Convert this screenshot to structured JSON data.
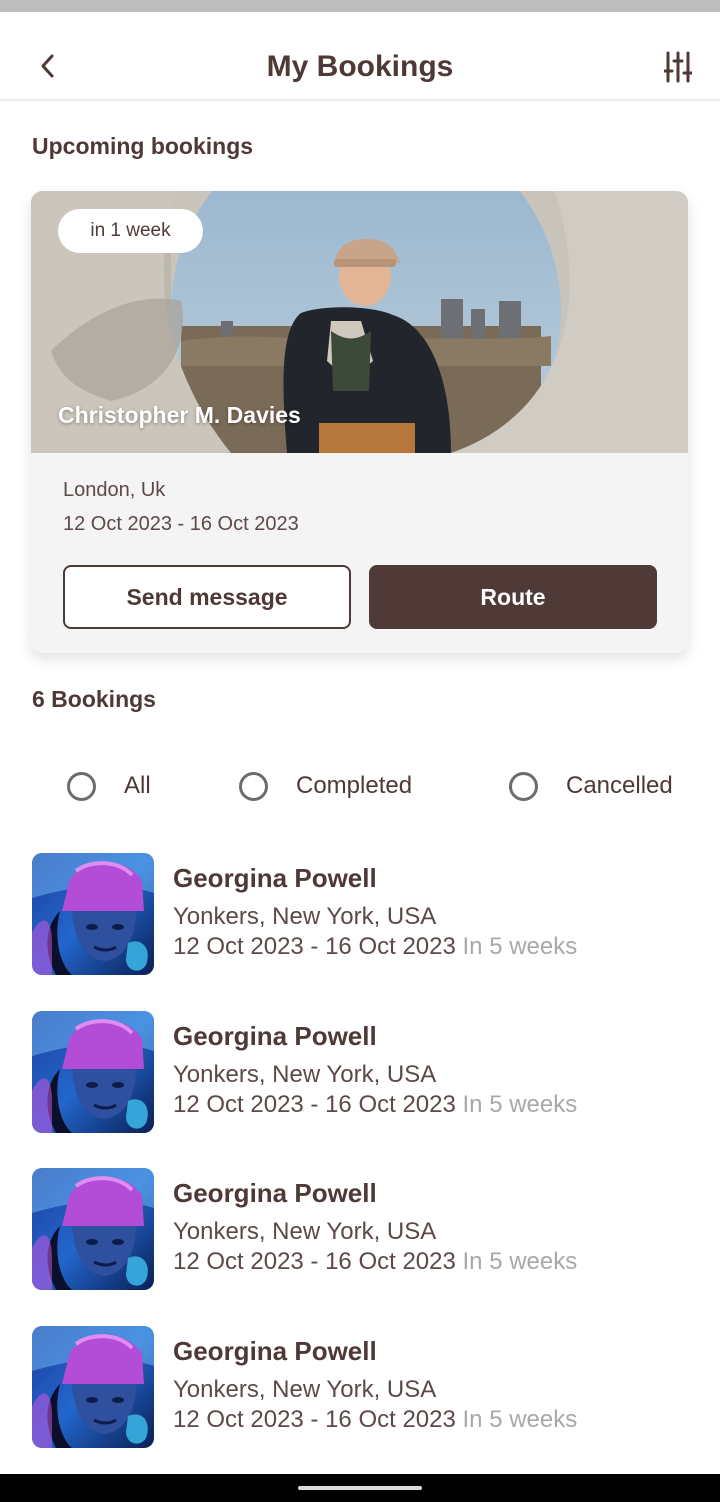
{
  "header": {
    "title": "My Bookings",
    "back_icon": "chevron-left-icon",
    "filter_icon": "sliders-icon"
  },
  "upcoming": {
    "section_title": "Upcoming bookings",
    "time_pill": "in 1 week",
    "host_name": "Christopher M. Davies",
    "location": "London, Uk",
    "dates": "12 Oct 2023 - 16 Oct 2023",
    "send_message_label": "Send message",
    "route_label": "Route"
  },
  "bookings": {
    "section_title": "6 Bookings",
    "filters": [
      {
        "label": "All"
      },
      {
        "label": "Completed"
      },
      {
        "label": "Cancelled"
      }
    ],
    "items": [
      {
        "name": "Georgina Powell",
        "location": "Yonkers, New York, USA",
        "dates": "12 Oct 2023 - 16 Oct 2023",
        "eta": "In 5 weeks"
      },
      {
        "name": "Georgina Powell",
        "location": "Yonkers, New York, USA",
        "dates": "12 Oct 2023 - 16 Oct 2023",
        "eta": "In 5 weeks"
      },
      {
        "name": "Georgina Powell",
        "location": "Yonkers, New York, USA",
        "dates": "12 Oct 2023 - 16 Oct 2023",
        "eta": "In 5 weeks"
      },
      {
        "name": "Georgina Powell",
        "location": "Yonkers, New York, USA",
        "dates": "12 Oct 2023 - 16 Oct 2023",
        "eta": "In 5 weeks"
      }
    ]
  },
  "colors": {
    "brand": "#4f3a37",
    "text_primary": "#4e3936",
    "text_muted": "#a8a8a8",
    "card_bg": "#f4f4f4"
  }
}
